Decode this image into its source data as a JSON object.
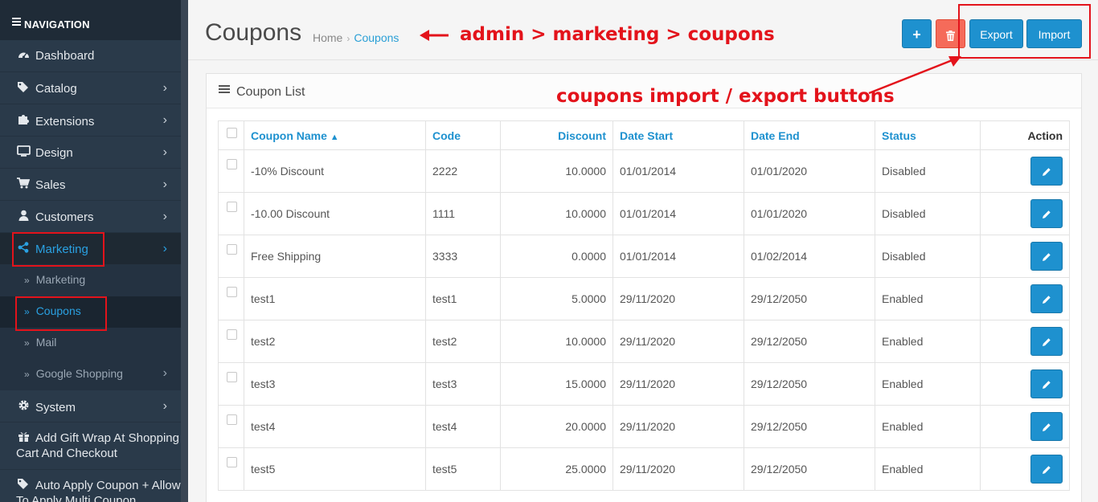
{
  "sidebar": {
    "header": "NAVIGATION",
    "items": [
      {
        "label": "Dashboard",
        "icon": "dashboard-icon"
      },
      {
        "label": "Catalog",
        "icon": "tags-icon"
      },
      {
        "label": "Extensions",
        "icon": "puzzle-icon"
      },
      {
        "label": "Design",
        "icon": "monitor-icon"
      },
      {
        "label": "Sales",
        "icon": "cart-icon"
      },
      {
        "label": "Customers",
        "icon": "user-icon"
      },
      {
        "label": "Marketing",
        "icon": "share-icon",
        "active": true
      }
    ],
    "submenu": [
      {
        "label": "Marketing"
      },
      {
        "label": "Coupons",
        "active": true
      },
      {
        "label": "Mail"
      },
      {
        "label": "Google Shopping"
      }
    ],
    "items_after": [
      {
        "label": "System",
        "icon": "gear-icon"
      },
      {
        "label": "Add Gift Wrap At Shopping Cart And Checkout",
        "icon": "gift-icon"
      },
      {
        "label": "Auto Apply Coupon + Allow To Apply Multi Coupon",
        "icon": "tag-icon"
      }
    ]
  },
  "header": {
    "title": "Coupons",
    "breadcrumb": {
      "home": "Home",
      "separator": "›",
      "current": "Coupons"
    },
    "buttons": {
      "add": "+",
      "delete": "trash-icon",
      "export": "Export",
      "import": "Import"
    }
  },
  "annotations": {
    "breadcrumb_note": "admin > marketing > coupons",
    "buttons_note": "coupons import / export buttons",
    "color": "#e3131b"
  },
  "panel": {
    "title": "Coupon List",
    "columns": [
      "Coupon Name",
      "Code",
      "Discount",
      "Date Start",
      "Date End",
      "Status",
      "Action"
    ],
    "sort_indicator": "^",
    "rows": [
      {
        "name": "-10% Discount",
        "code": "2222",
        "discount": "10.0000",
        "start": "01/01/2014",
        "end": "01/01/2020",
        "status": "Disabled"
      },
      {
        "name": "-10.00 Discount",
        "code": "1111",
        "discount": "10.0000",
        "start": "01/01/2014",
        "end": "01/01/2020",
        "status": "Disabled"
      },
      {
        "name": "Free Shipping",
        "code": "3333",
        "discount": "0.0000",
        "start": "01/01/2014",
        "end": "01/02/2014",
        "status": "Disabled"
      },
      {
        "name": "test1",
        "code": "test1",
        "discount": "5.0000",
        "start": "29/11/2020",
        "end": "29/12/2050",
        "status": "Enabled"
      },
      {
        "name": "test2",
        "code": "test2",
        "discount": "10.0000",
        "start": "29/11/2020",
        "end": "29/12/2050",
        "status": "Enabled"
      },
      {
        "name": "test3",
        "code": "test3",
        "discount": "15.0000",
        "start": "29/11/2020",
        "end": "29/12/2050",
        "status": "Enabled"
      },
      {
        "name": "test4",
        "code": "test4",
        "discount": "20.0000",
        "start": "29/11/2020",
        "end": "29/12/2050",
        "status": "Enabled"
      },
      {
        "name": "test5",
        "code": "test5",
        "discount": "25.0000",
        "start": "29/11/2020",
        "end": "29/12/2050",
        "status": "Enabled"
      }
    ]
  },
  "colors": {
    "sidebar": "#2a3a4a",
    "accent": "#1e91cf",
    "danger": "#f56b5a",
    "highlight": "#e3131b"
  }
}
